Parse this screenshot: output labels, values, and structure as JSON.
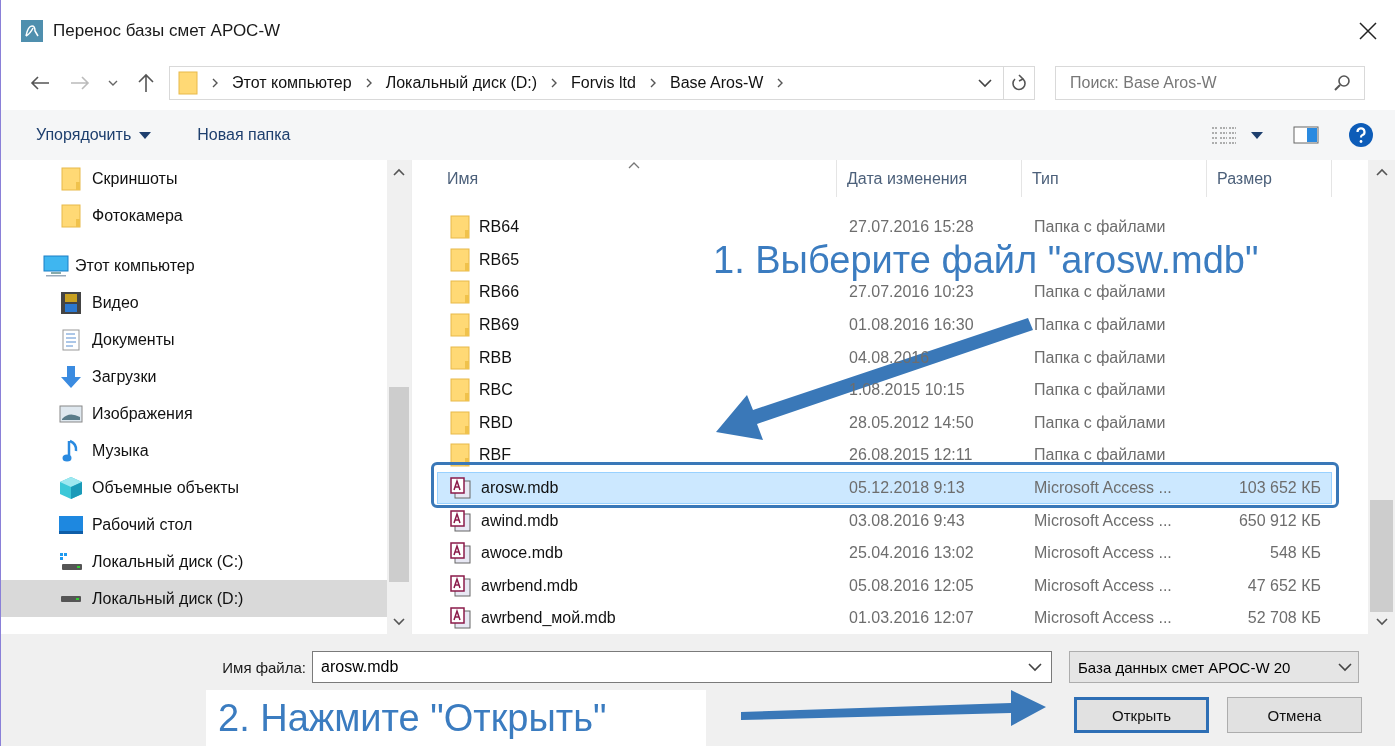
{
  "window": {
    "title": "Перенос базы смет АРОС-W"
  },
  "address": {
    "crumbs": [
      "Этот компьютер",
      "Локальный диск (D:)",
      "Forvis ltd",
      "Base Aros-W"
    ]
  },
  "search": {
    "placeholder": "Поиск: Base Aros-W"
  },
  "toolbar": {
    "organize": "Упорядочить",
    "new_folder": "Новая папка"
  },
  "sidebar": {
    "scrolled_children": [
      {
        "label": "Скриншоты",
        "kind": "folder",
        "selected": false
      },
      {
        "label": "Фотокамера",
        "kind": "folder",
        "selected": false
      }
    ],
    "items": [
      {
        "label": "Этот компьютер",
        "kind": "computer",
        "selected": false,
        "children": [
          {
            "label": "Видео",
            "kind": "video",
            "selected": false
          },
          {
            "label": "Документы",
            "kind": "documents",
            "selected": false
          },
          {
            "label": "Загрузки",
            "kind": "downloads",
            "selected": false
          },
          {
            "label": "Изображения",
            "kind": "pictures",
            "selected": false
          },
          {
            "label": "Музыка",
            "kind": "music",
            "selected": false
          },
          {
            "label": "Объемные объекты",
            "kind": "objects3d",
            "selected": false
          },
          {
            "label": "Рабочий стол",
            "kind": "desktop",
            "selected": false
          },
          {
            "label": "Локальный диск (C:)",
            "kind": "system_drive",
            "selected": false
          },
          {
            "label": "Локальный диск (D:)",
            "kind": "drive",
            "selected": true
          }
        ]
      }
    ]
  },
  "table": {
    "columns": [
      "Имя",
      "Дата изменения",
      "Тип",
      "Размер"
    ],
    "rows": [
      {
        "name": "RB64",
        "kind": "folder",
        "date": "27.07.2016 15:28",
        "type": "Папка с файлами",
        "selected": false
      },
      {
        "name": "RB65",
        "kind": "folder",
        "selected": false
      },
      {
        "name": "RB66",
        "kind": "folder",
        "date": "27.07.2016 10:23",
        "type": "Папка с файлами",
        "selected": false
      },
      {
        "name": "RB69",
        "kind": "folder",
        "date": "01.08.2016 16:30",
        "type": "Папка с файлами",
        "selected": false
      },
      {
        "name": "RBB",
        "kind": "folder",
        "date": "04.08.2016",
        "type": "Папка с файлами",
        "selected": false
      },
      {
        "name": "RBC",
        "kind": "folder",
        "date": "1.08.2015 10:15",
        "type": "Папка с файлами",
        "selected": false
      },
      {
        "name": "RBD",
        "kind": "folder",
        "date": "28.05.2012 14:50",
        "type": "Папка с файлами",
        "selected": false
      },
      {
        "name": "RBF",
        "kind": "folder",
        "date": "26.08.2015 12:11",
        "type": "Папка с файлами",
        "selected": false
      },
      {
        "name": "arosw.mdb",
        "kind": "access",
        "date": "05.12.2018 9:13",
        "type": "Microsoft Access ...",
        "size": "103 652 КБ",
        "selected": true
      },
      {
        "name": "awind.mdb",
        "kind": "access",
        "date": "03.08.2016 9:43",
        "type": "Microsoft Access ...",
        "size": "650 912 КБ",
        "selected": false
      },
      {
        "name": "awoce.mdb",
        "kind": "access",
        "date": "25.04.2016 13:02",
        "type": "Microsoft Access ...",
        "size": "548 КБ",
        "selected": false
      },
      {
        "name": "awrbend.mdb",
        "kind": "access",
        "date": "05.08.2016 12:05",
        "type": "Microsoft Access ...",
        "size": "47 652 КБ",
        "selected": false
      },
      {
        "name": "awrbend_мой.mdb",
        "kind": "access",
        "date": "01.03.2016 12:07",
        "type": "Microsoft Access ...",
        "size": "52 708 КБ",
        "selected": false
      }
    ]
  },
  "footer": {
    "filename_label": "Имя файла:",
    "filename": "arosw.mdb",
    "filetype": "База данных смет АРОС-W 20",
    "buttons": [
      {
        "label": "Открыть",
        "default": true
      },
      {
        "label": "Отмена",
        "default": false
      }
    ]
  },
  "annotations": [
    {
      "text": "1. Выберите файл \"arosw.mdb\""
    },
    {
      "text": "2. Нажмите \"Открыть\""
    }
  ]
}
